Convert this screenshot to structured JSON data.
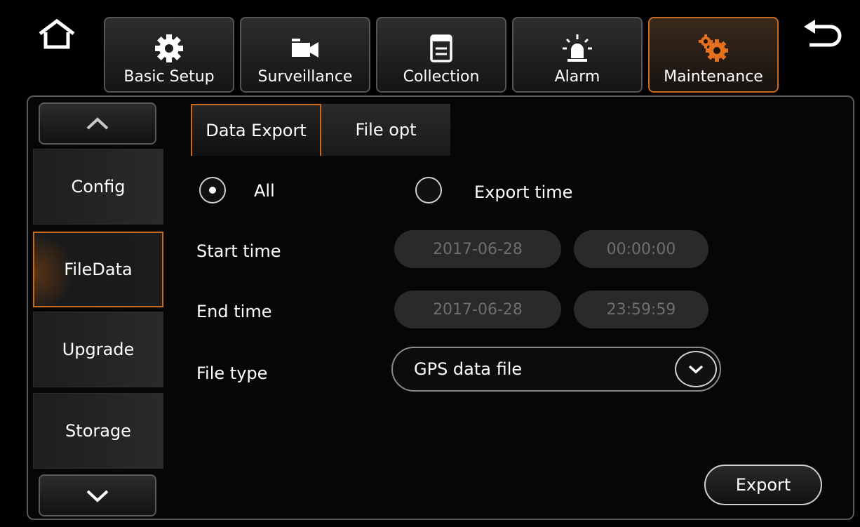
{
  "top_bar": {
    "tabs": [
      {
        "label": "Basic Setup"
      },
      {
        "label": "Surveillance"
      },
      {
        "label": "Collection"
      },
      {
        "label": "Alarm"
      },
      {
        "label": "Maintenance",
        "active": true
      }
    ]
  },
  "sidebar": {
    "items": [
      {
        "label": "Config"
      },
      {
        "label": "FileData",
        "active": true
      },
      {
        "label": "Upgrade"
      },
      {
        "label": "Storage"
      }
    ]
  },
  "sub_tabs": [
    {
      "label": "Data Export",
      "active": true
    },
    {
      "label": "File opt"
    }
  ],
  "form": {
    "radio_all_label": "All",
    "radio_export_time_label": "Export time",
    "selected_option": "All",
    "start_time_label": "Start time",
    "start_date": "2017-06-28",
    "start_clock": "00:00:00",
    "end_time_label": "End time",
    "end_date": "2017-06-28",
    "end_clock": "23:59:59",
    "file_type_label": "File type",
    "file_type_value": "GPS data file",
    "export_button": "Export"
  },
  "colors": {
    "accent": "#c96a1e",
    "background": "#000000",
    "disabled_field": "#2a2a2a"
  }
}
